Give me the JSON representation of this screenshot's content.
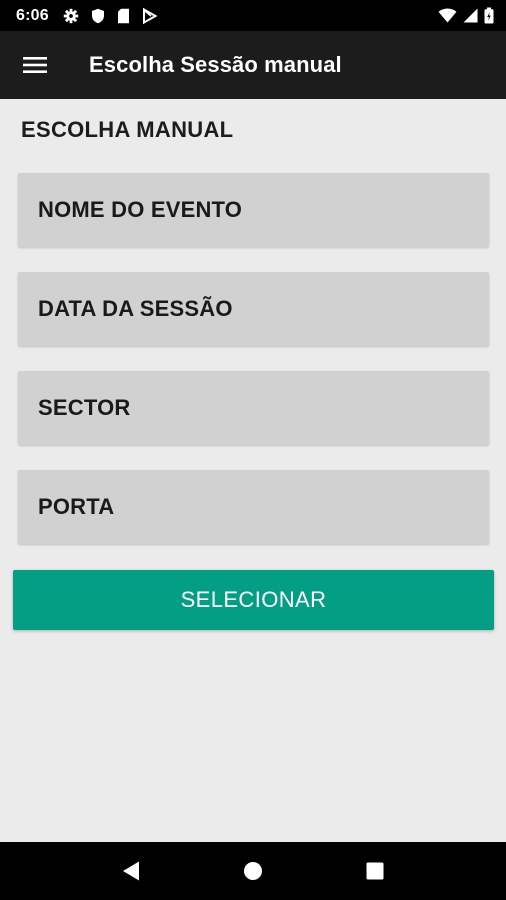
{
  "status_bar": {
    "time": "6:06",
    "left_icons": [
      "gear-icon",
      "shield-icon",
      "sd-card-icon",
      "play-store-icon"
    ],
    "right_icons": [
      "wifi-icon",
      "signal-icon",
      "battery-icon"
    ]
  },
  "app_bar": {
    "menu_icon": "hamburger-menu-icon",
    "title": "Escolha Sessão manual"
  },
  "main": {
    "section_title": "ESCOLHA MANUAL",
    "fields": [
      {
        "label": "NOME DO EVENTO"
      },
      {
        "label": "DATA DA SESSÃO"
      },
      {
        "label": "SECTOR"
      },
      {
        "label": "PORTA"
      }
    ],
    "select_button_label": "SELECIONAR"
  },
  "nav_bar": {
    "buttons": [
      "back-icon",
      "home-icon",
      "recents-icon"
    ]
  },
  "colors": {
    "accent": "#049e84",
    "app_bar": "#1c1c1c",
    "field_bg": "#d1d1d1",
    "page_bg": "#ebebeb"
  }
}
